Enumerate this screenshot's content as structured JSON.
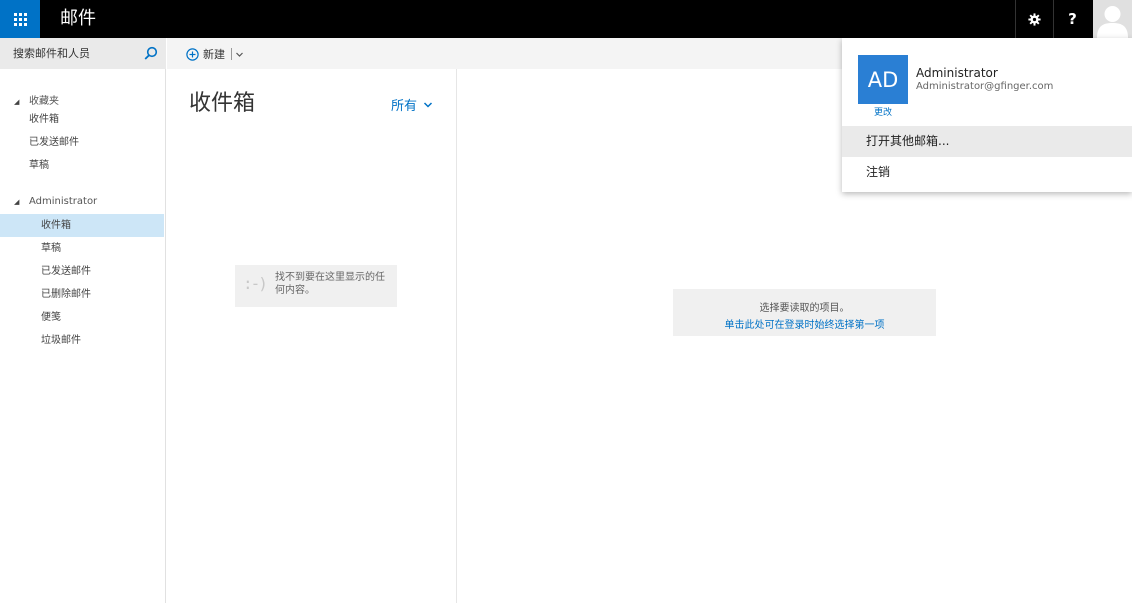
{
  "app": {
    "title": "邮件"
  },
  "topbar": {
    "help_label": "?"
  },
  "search": {
    "placeholder": "搜索邮件和人员"
  },
  "toolbar": {
    "new_label": "新建"
  },
  "favorites": {
    "label": "收藏夹",
    "items": [
      "收件箱",
      "已发送邮件",
      "草稿"
    ]
  },
  "mailbox": {
    "label": "Administrator",
    "items": [
      "收件箱",
      "草稿",
      "已发送邮件",
      "已删除邮件",
      "便笺",
      "垃圾邮件"
    ],
    "selected_index": 0
  },
  "list": {
    "title": "收件箱",
    "filter_label": "所有",
    "empty_face": ":-)",
    "empty_text": "找不到要在这里显示的任何内容。"
  },
  "reading": {
    "line1": "选择要读取的项目。",
    "line2": "单击此处可在登录时始终选择第一项"
  },
  "account": {
    "initials": "AD",
    "change_label": "更改",
    "name": "Administrator",
    "email": "Administrator@gfinger.com",
    "menu": [
      "打开其他邮箱...",
      "注销"
    ]
  },
  "colors": {
    "accent": "#0072c6",
    "selected_bg": "#cde6f7",
    "tile_bg": "#2a7fd4"
  }
}
